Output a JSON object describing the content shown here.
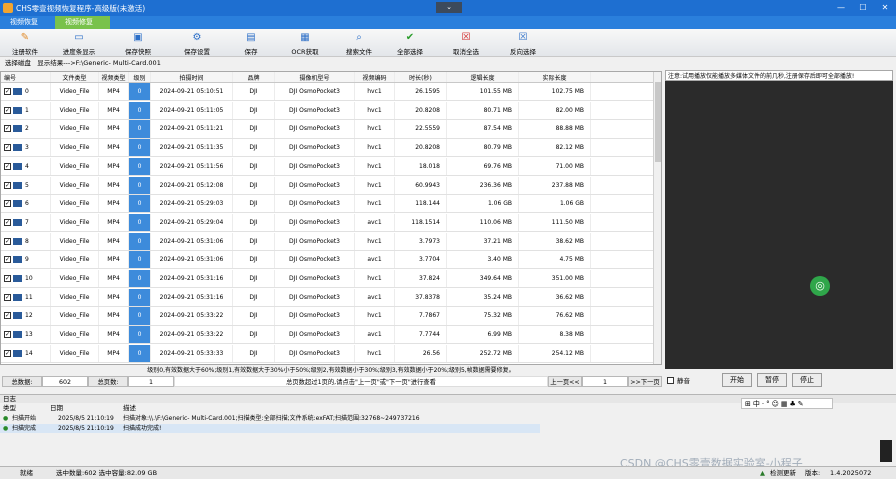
{
  "window": {
    "title": "CHS零壹视频恢复程序-高级版(未激活)",
    "collapse_glyph": "⌄",
    "minimize": "—",
    "maximize": "☐",
    "close": "✕"
  },
  "tabs": [
    "视频恢复",
    "视频修复"
  ],
  "toolbar": [
    {
      "label": "注册软件",
      "icon": "register-icon"
    },
    {
      "label": "进度条显示",
      "icon": "progress-icon"
    },
    {
      "label": "保存快照",
      "icon": "snapshot-icon"
    },
    {
      "label": "保存设置",
      "icon": "settings-icon"
    },
    {
      "label": "保存",
      "icon": "save-icon"
    },
    {
      "label": "OCR获取",
      "icon": "ocr-icon"
    },
    {
      "label": "搜索文件",
      "icon": "search-icon"
    },
    {
      "label": "全部选择",
      "icon": "check-all-icon"
    },
    {
      "label": "取消全选",
      "icon": "uncheck-all-icon"
    },
    {
      "label": "反向选择",
      "icon": "invert-select-icon"
    }
  ],
  "path": {
    "label": "选择磁盘",
    "value": "显示结果--->F:\\Generic- Multi-Card.001"
  },
  "table": {
    "headers": [
      "编号",
      "文件类型",
      "视频类型",
      "级别",
      "拍摄时间",
      "品牌",
      "摄像机型号",
      "视频编码",
      "时长(秒)",
      "逻辑长度",
      "实际长度"
    ],
    "rows": [
      [
        "0",
        "Video_File",
        "MP4",
        "0",
        "2024-09-21 05:10:51",
        "DJI",
        "DJI OsmoPocket3",
        "hvc1",
        "26.1595",
        "101.55 MB",
        "102.75 MB"
      ],
      [
        "1",
        "Video_File",
        "MP4",
        "0",
        "2024-09-21 05:11:05",
        "DJI",
        "DJI OsmoPocket3",
        "hvc1",
        "20.8208",
        "80.71 MB",
        "82.00 MB"
      ],
      [
        "2",
        "Video_File",
        "MP4",
        "0",
        "2024-09-21 05:11:21",
        "DJI",
        "DJI OsmoPocket3",
        "hvc1",
        "22.5559",
        "87.54 MB",
        "88.88 MB"
      ],
      [
        "3",
        "Video_File",
        "MP4",
        "0",
        "2024-09-21 05:11:35",
        "DJI",
        "DJI OsmoPocket3",
        "hvc1",
        "20.8208",
        "80.79 MB",
        "82.12 MB"
      ],
      [
        "4",
        "Video_File",
        "MP4",
        "0",
        "2024-09-21 05:11:56",
        "DJI",
        "DJI OsmoPocket3",
        "hvc1",
        "18.018",
        "69.76 MB",
        "71.00 MB"
      ],
      [
        "5",
        "Video_File",
        "MP4",
        "0",
        "2024-09-21 05:12:08",
        "DJI",
        "DJI OsmoPocket3",
        "hvc1",
        "60.9943",
        "236.36 MB",
        "237.88 MB"
      ],
      [
        "6",
        "Video_File",
        "MP4",
        "0",
        "2024-09-21 05:29:03",
        "DJI",
        "DJI OsmoPocket3",
        "hvc1",
        "118.144",
        "1.06 GB",
        "1.06 GB"
      ],
      [
        "7",
        "Video_File",
        "MP4",
        "0",
        "2024-09-21 05:29:04",
        "DJI",
        "DJI OsmoPocket3",
        "avc1",
        "118.1514",
        "110.06 MB",
        "111.50 MB"
      ],
      [
        "8",
        "Video_File",
        "MP4",
        "0",
        "2024-09-21 05:31:06",
        "DJI",
        "DJI OsmoPocket3",
        "hvc1",
        "3.7973",
        "37.21 MB",
        "38.62 MB"
      ],
      [
        "9",
        "Video_File",
        "MP4",
        "0",
        "2024-09-21 05:31:06",
        "DJI",
        "DJI OsmoPocket3",
        "avc1",
        "3.7704",
        "3.40 MB",
        "4.75 MB"
      ],
      [
        "10",
        "Video_File",
        "MP4",
        "0",
        "2024-09-21 05:31:16",
        "DJI",
        "DJI OsmoPocket3",
        "hvc1",
        "37.824",
        "349.64 MB",
        "351.00 MB"
      ],
      [
        "11",
        "Video_File",
        "MP4",
        "0",
        "2024-09-21 05:31:16",
        "DJI",
        "DJI OsmoPocket3",
        "avc1",
        "37.8378",
        "35.24 MB",
        "36.62 MB"
      ],
      [
        "12",
        "Video_File",
        "MP4",
        "0",
        "2024-09-21 05:33:22",
        "DJI",
        "DJI OsmoPocket3",
        "hvc1",
        "7.7867",
        "75.32 MB",
        "76.62 MB"
      ],
      [
        "13",
        "Video_File",
        "MP4",
        "0",
        "2024-09-21 05:33:22",
        "DJI",
        "DJI OsmoPocket3",
        "avc1",
        "7.7744",
        "6.99 MB",
        "8.38 MB"
      ],
      [
        "14",
        "Video_File",
        "MP4",
        "0",
        "2024-09-21 05:33:33",
        "DJI",
        "DJI OsmoPocket3",
        "hvc1",
        "26.56",
        "252.72 MB",
        "254.12 MB"
      ]
    ]
  },
  "info_text": "级别0,有效数据大于60%;级别1,有效数据大于30%小于50%;级别2,有效数据小于30%;级别3,有效数据小于20%;级别5,帧数据需要修复。",
  "pager": {
    "total_label": "总数据:",
    "total_value": "602",
    "pages_label": "总页数:",
    "pages_value": "1",
    "hint": "总页数超过1页的,请点击\"上一页\"或\"下一页\"进行查看",
    "prev": "上一页<<",
    "page_input": "1",
    "next": ">>下一页"
  },
  "player": {
    "notice": "注意:试用播放仅能播放多媒体文件的前几秒,注册保存后即可全部播放!",
    "mute_label": "静音",
    "start": "开始",
    "pause": "暂停",
    "stop": "停止"
  },
  "log": {
    "title": "日志",
    "headers": [
      "类型",
      "日期",
      "描述"
    ],
    "rows": [
      {
        "type": "扫描开始",
        "date": "2025/8/5 21:10:19",
        "desc": "扫描对象:\\\\.\\F:\\Generic- Multi-Card.001;扫描类型:全部扫描;文件系统:exFAT;扫描范围:32768~249737216"
      },
      {
        "type": "扫描完成",
        "date": "2025/8/5 21:10:19",
        "desc": "扫描成功完成!"
      }
    ]
  },
  "ime_toolbar": "⊞中·°☺▦♣✎",
  "status": {
    "ready": "就绪",
    "selection": "选中数量:602 选中容量:82.09 GB",
    "update": "检测更新",
    "version_label": "版本:",
    "version": "1.4.2025072"
  },
  "watermark": "CSDN @CHS零壹数据实验室-小程子"
}
